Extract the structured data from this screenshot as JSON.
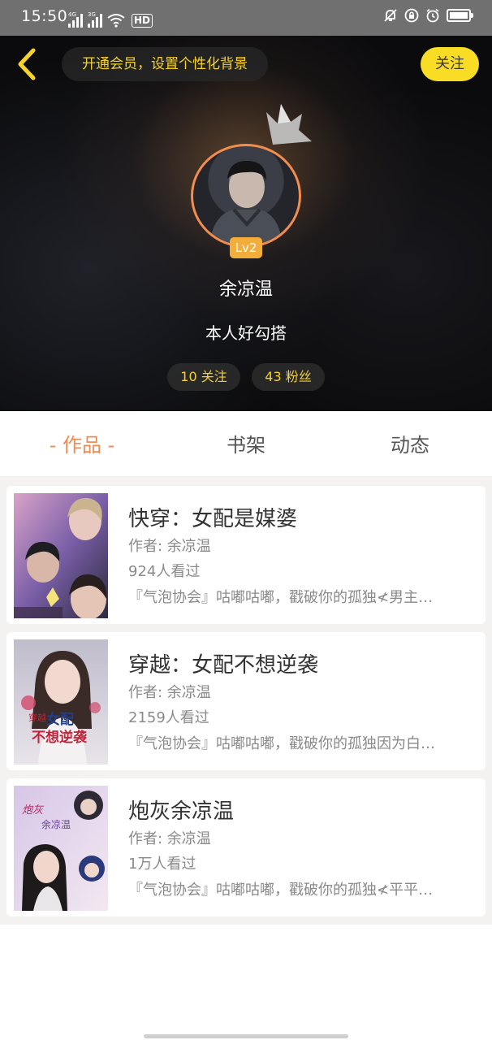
{
  "status_bar": {
    "time": "15:50",
    "signal_1_tag": "4G",
    "signal_2_tag": "3G",
    "hd_label": "HD"
  },
  "header": {
    "vip_banner": "开通会员，设置个性化背景",
    "follow_label": "关注",
    "level": "Lv2",
    "username": "余凉温",
    "bio": "本人好勾搭",
    "following": "10 关注",
    "fans": "43 粉丝"
  },
  "tabs": [
    {
      "label": "- 作品 -",
      "active": true
    },
    {
      "label": "书架",
      "active": false
    },
    {
      "label": "动态",
      "active": false
    }
  ],
  "books": [
    {
      "title": "快穿：女配是媒婆",
      "author": "作者: 余凉温",
      "views": "924人看过",
      "desc": "『气泡协会』咕嘟咕嘟，戳破你的孤独≮男主…"
    },
    {
      "title": "穿越：女配不想逆袭",
      "author": "作者: 余凉温",
      "views": "2159人看过",
      "desc": "『气泡协会』咕嘟咕嘟，戳破你的孤独因为白…",
      "cover_text_1": "穿越",
      "cover_text_2": "女配",
      "cover_text_3": "不想逆袭"
    },
    {
      "title": "炮灰余凉温",
      "author": "作者: 余凉温",
      "views": "1万人看过",
      "desc": "『气泡协会』咕嘟咕嘟，戳破你的孤独≮平平…",
      "cover_text_1": "炮灰",
      "cover_text_2": "余凉温"
    }
  ],
  "colors": {
    "accent": "#f08b51",
    "follow_yellow": "#f9dd24",
    "stat_text": "#f6cf2b",
    "level_badge": "#f3ad3b"
  }
}
